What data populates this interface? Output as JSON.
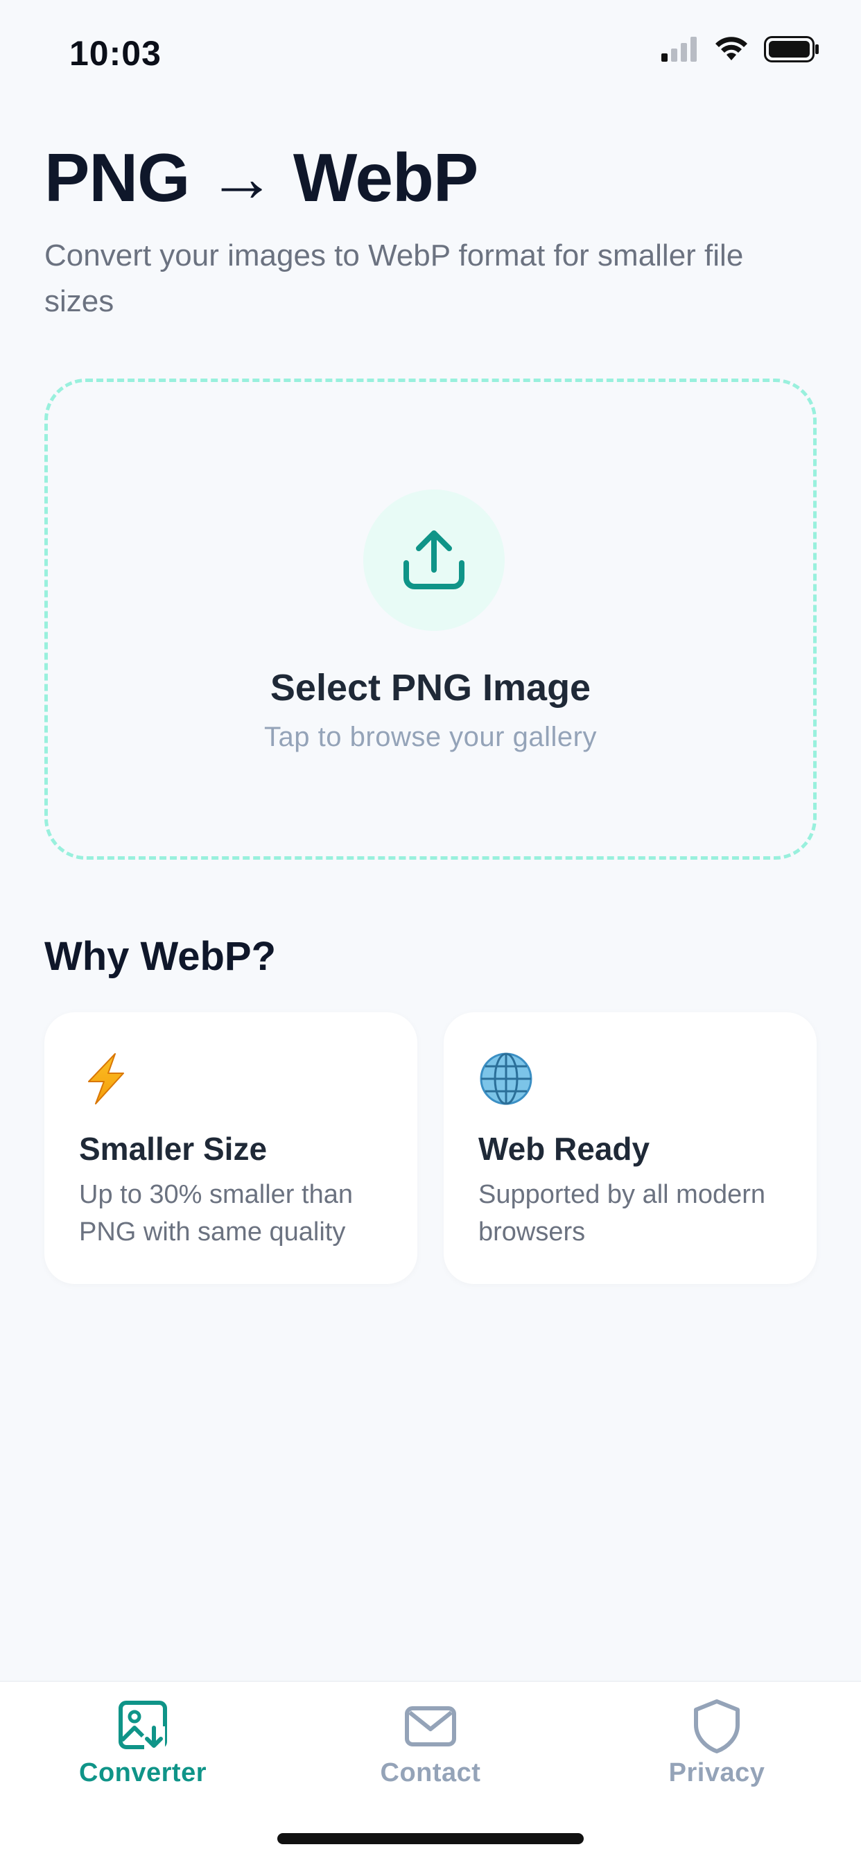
{
  "status_bar": {
    "time": "10:03"
  },
  "header": {
    "title": "PNG → WebP",
    "subtitle": "Convert your images to WebP format for smaller file sizes"
  },
  "upload": {
    "title": "Select PNG Image",
    "hint": "Tap to browse your gallery",
    "icon": "upload-icon"
  },
  "why": {
    "title": "Why WebP?",
    "features": [
      {
        "icon": "lightning-icon",
        "title": "Smaller Size",
        "description": "Up to 30% smaller than PNG with same quality"
      },
      {
        "icon": "globe-icon",
        "title": "Web Ready",
        "description": "Supported by all modern browsers"
      }
    ]
  },
  "tabs": [
    {
      "label": "Converter",
      "icon": "image-download-icon",
      "active": true
    },
    {
      "label": "Contact",
      "icon": "envelope-icon",
      "active": false
    },
    {
      "label": "Privacy",
      "icon": "shield-icon",
      "active": false
    }
  ],
  "colors": {
    "accent": "#0f9488",
    "dashed_border": "#99f0dd",
    "background": "#f7f9fc",
    "inactive": "#94a3b8"
  }
}
